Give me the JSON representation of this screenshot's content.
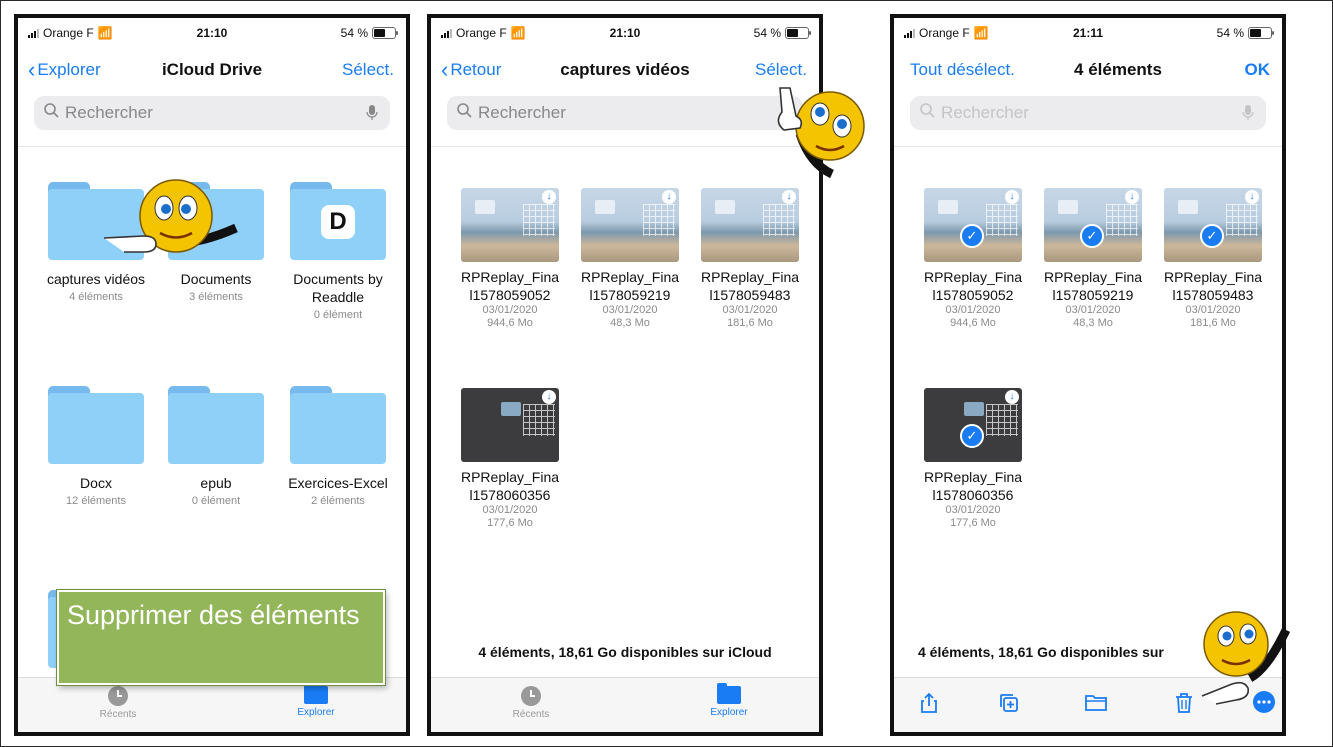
{
  "status": {
    "carrier": "Orange F",
    "battery": "54 %"
  },
  "screens": [
    {
      "time": "21:10",
      "nav": {
        "back": "Explorer",
        "title": "iCloud Drive",
        "right": "Sélect."
      },
      "search_placeholder": "Rechercher",
      "folders": [
        {
          "name": "captures vidéos",
          "count": "4 éléments"
        },
        {
          "name": "Documents",
          "count": "3 éléments"
        },
        {
          "name": "Documents by Readdle",
          "count": "0 élément"
        },
        {
          "name": "Docx",
          "count": "12 éléments"
        },
        {
          "name": "epub",
          "count": "0 élément"
        },
        {
          "name": "Exercices-Excel",
          "count": "2 éléments"
        }
      ],
      "tabs": [
        "Récents",
        "Explorer"
      ],
      "banner": "Supprimer des éléments"
    },
    {
      "time": "21:10",
      "nav": {
        "back": "Retour",
        "title": "captures vidéos",
        "right": "Sélect."
      },
      "search_placeholder": "Rechercher",
      "files": [
        {
          "name1": "RPReplay_Fina",
          "name2": "l1578059052",
          "date": "03/01/2020",
          "size": "944,6 Mo"
        },
        {
          "name1": "RPReplay_Fina",
          "name2": "l1578059219",
          "date": "03/01/2020",
          "size": "48,3 Mo"
        },
        {
          "name1": "RPReplay_Fina",
          "name2": "l1578059483",
          "date": "03/01/2020",
          "size": "181,6 Mo"
        },
        {
          "name1": "RPReplay_Fina",
          "name2": "l1578060356",
          "date": "03/01/2020",
          "size": "177,6 Mo"
        }
      ],
      "footer": "4 éléments, 18,61 Go disponibles sur iCloud",
      "tabs": [
        "Récents",
        "Explorer"
      ]
    },
    {
      "time": "21:11",
      "nav": {
        "back": "Tout désélect.",
        "title": "4 éléments",
        "right": "OK"
      },
      "search_placeholder": "Rechercher",
      "footer": "4 éléments, 18,61 Go disponibles sur"
    }
  ],
  "colors": {
    "accent": "#1a7cf5",
    "folder": "#8fd0f8",
    "banner": "#93b65a"
  }
}
